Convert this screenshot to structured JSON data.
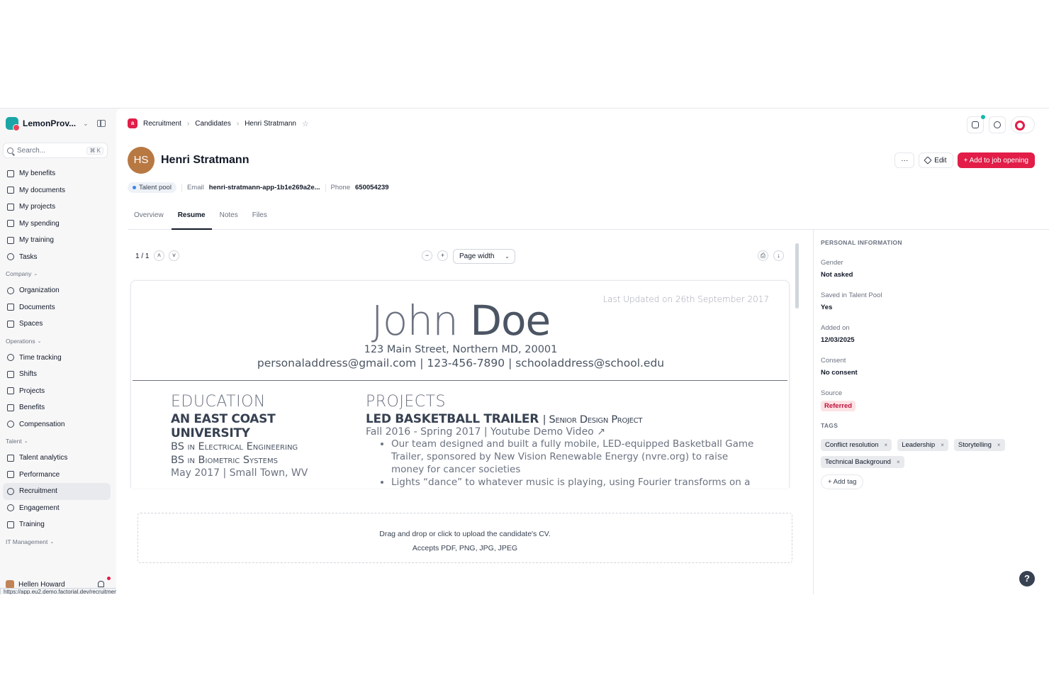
{
  "sidebar": {
    "brand": "LemonProv...",
    "search_placeholder": "Search...",
    "shortcut": "⌘ K",
    "items_top": [
      "My benefits",
      "My documents",
      "My projects",
      "My spending",
      "My training",
      "Tasks"
    ],
    "company_label": "Company",
    "company_items": [
      "Organization",
      "Documents",
      "Spaces"
    ],
    "operations_label": "Operations",
    "operations_items": [
      "Time tracking",
      "Shifts",
      "Projects",
      "Benefits",
      "Compensation"
    ],
    "talent_label": "Talent",
    "talent_items": [
      "Talent analytics",
      "Performance",
      "Recruitment",
      "Engagement",
      "Training"
    ],
    "it_label": "IT Management",
    "user_name": "Hellen Howard",
    "status_url": "https://app.eu2.demo.factorial.dev/recruitment/candidates/432866/cv"
  },
  "breadcrumb": {
    "app": "Recruitment",
    "section": "Candidates",
    "current": "Henri Stratmann"
  },
  "candidate": {
    "initials": "HS",
    "name": "Henri Stratmann",
    "pool": "Talent pool",
    "email_label": "Email",
    "email": "henri-stratmann-app-1b1e269a2e...",
    "phone_label": "Phone",
    "phone": "650054239"
  },
  "actions": {
    "more": "···",
    "edit": "Edit",
    "add_job": "+ Add to job opening"
  },
  "tabs": [
    "Overview",
    "Resume",
    "Notes",
    "Files"
  ],
  "viewer": {
    "page": "1 / 1",
    "zoom": "Page width"
  },
  "resume": {
    "updated": "Last Updated on 26th September 2017",
    "first_name": "John",
    "last_name": "Doe",
    "address": "123 Main Street, Northern MD, 20001",
    "contacts": "personaladdress@gmail.com | 123-456-7890 | schooladdress@school.edu",
    "education_heading": "EDUCATION",
    "university": "AN EAST COAST UNIVERSITY",
    "degree1": "BS in Electrical Engineering",
    "degree2": "BS in Biometric Systems",
    "edu_date": "May 2017 | Small Town, WV",
    "projects_heading": "PROJECTS",
    "project_title": "LED BASKETBALL TRAILER",
    "project_sub": "| Senior Design Project",
    "project_dates": "Fall 2016 - Spring 2017 | Youtube Demo Video ↗",
    "bullet1": "Our team designed and built a fully mobile, LED-equipped Basketball Game Trailer, sponsored by New Vision Renewable Energy (nvre.org) to raise money for cancer societies",
    "bullet2": "Lights “dance” to whatever music is playing, using Fourier transforms on a"
  },
  "upload": {
    "line1": "Drag and drop or click to upload the candidate's CV.",
    "line2": "Accepts PDF, PNG, JPG, JPEG"
  },
  "panel": {
    "heading": "PERSONAL INFORMATION",
    "gender_label": "Gender",
    "gender": "Not asked",
    "saved_label": "Saved in Talent Pool",
    "saved": "Yes",
    "added_label": "Added on",
    "added": "12/03/2025",
    "consent_label": "Consent",
    "consent": "No consent",
    "source_label": "Source",
    "source": "Referred",
    "tags_heading": "TAGS",
    "tags": [
      "Conflict resolution",
      "Leadership",
      "Storytelling",
      "Technical Background"
    ],
    "add_tag": "+ Add tag",
    "help": "?"
  },
  "colors": {
    "accent": "#e11d48",
    "avatar": "#b87842",
    "referred_bg": "#fde2e4"
  }
}
